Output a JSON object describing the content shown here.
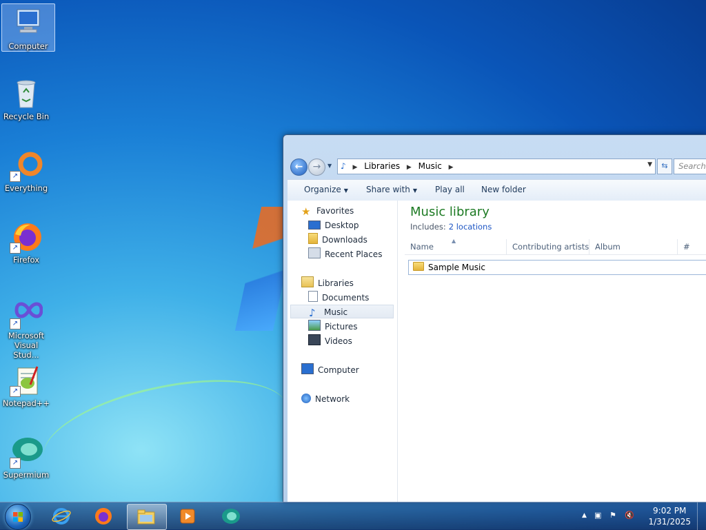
{
  "desktop": {
    "icons": [
      {
        "label": "Computer"
      },
      {
        "label": "Recycle Bin"
      },
      {
        "label": "Everything"
      },
      {
        "label": "Firefox"
      },
      {
        "label": "Microsoft Visual Stud..."
      },
      {
        "label": "Notepad++"
      },
      {
        "label": "Supermium"
      }
    ]
  },
  "explorer": {
    "breadcrumb": [
      "Libraries",
      "Music"
    ],
    "search_placeholder": "Search Mu",
    "toolbar": {
      "organize": "Organize",
      "share_with": "Share with",
      "play_all": "Play all",
      "new_folder": "New folder"
    },
    "nav": {
      "favorites": "Favorites",
      "desktop": "Desktop",
      "downloads": "Downloads",
      "recent_places": "Recent Places",
      "libraries": "Libraries",
      "documents": "Documents",
      "music": "Music",
      "pictures": "Pictures",
      "videos": "Videos",
      "computer": "Computer",
      "network": "Network"
    },
    "library_title": "Music library",
    "includes_label": "Includes:",
    "includes_link": "2 locations",
    "columns": {
      "name": "Name",
      "artists": "Contributing artists",
      "album": "Album",
      "number": "#"
    },
    "rows": [
      {
        "name": "Sample Music"
      }
    ]
  },
  "taskbar": {
    "clock_time": "9:02 PM",
    "clock_date": "1/31/2025"
  },
  "colors": {
    "library_title": "#1d7a23",
    "link": "#1e56c4"
  }
}
